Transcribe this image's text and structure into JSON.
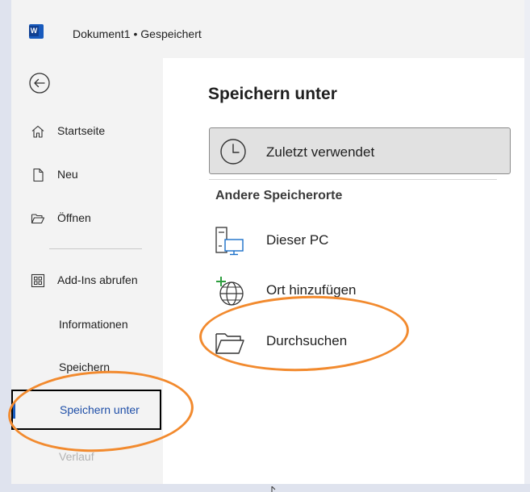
{
  "titlebar": {
    "app_icon": "word-logo-icon",
    "app_letter": "W",
    "title": "Dokument1 • Gespeichert"
  },
  "nav": {
    "back_icon": "back-arrow-circle-icon",
    "items": [
      {
        "label": "Startseite",
        "icon": "home-icon"
      },
      {
        "label": "Neu",
        "icon": "new-document-icon"
      },
      {
        "label": "Öffnen",
        "icon": "folder-open-icon"
      },
      {
        "label": "Add-Ins abrufen",
        "icon": "add-ins-grid-icon"
      },
      {
        "label": "Informationen"
      },
      {
        "label": "Speichern"
      },
      {
        "label": "Speichern unter",
        "selected": true
      },
      {
        "label": "Verlauf",
        "faded": true
      }
    ]
  },
  "main": {
    "title": "Speichern unter",
    "recent": {
      "label": "Zuletzt verwendet",
      "icon": "clock-icon"
    },
    "other_section_title": "Andere Speicherorte",
    "locations": [
      {
        "label": "Dieser PC",
        "icon": "this-pc-icon"
      },
      {
        "label": "Ort hinzufügen",
        "icon": "add-place-globe-icon"
      },
      {
        "label": "Durchsuchen",
        "icon": "browse-folder-icon"
      }
    ]
  },
  "colors": {
    "accent": "#185abd",
    "selected_text": "#1f4fa8",
    "annotation": "#f28a2e"
  }
}
